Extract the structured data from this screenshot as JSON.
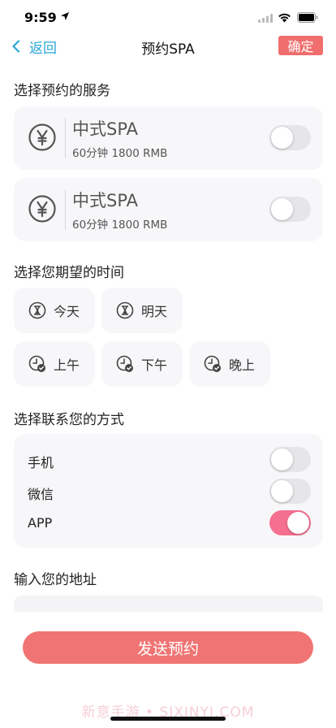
{
  "status_bar": {
    "time": "9:59"
  },
  "nav": {
    "back_label": "返回",
    "title": "预约SPA",
    "confirm_label": "确定"
  },
  "sections": {
    "service": "选择预约的服务",
    "time": "选择您期望的时间",
    "contact": "选择联系您的方式",
    "address": "输入您的地址"
  },
  "services": [
    {
      "name": "中式SPA",
      "detail": "60分钟   1800 RMB",
      "selected": false
    },
    {
      "name": "中式SPA",
      "detail": "60分钟   1800 RMB",
      "selected": false
    }
  ],
  "days": [
    {
      "label": "今天"
    },
    {
      "label": "明天"
    }
  ],
  "periods": [
    {
      "label": "上午"
    },
    {
      "label": "下午"
    },
    {
      "label": "晚上"
    }
  ],
  "contacts": [
    {
      "label": "手机",
      "enabled": false
    },
    {
      "label": "微信",
      "enabled": false
    },
    {
      "label": "APP",
      "enabled": true
    }
  ],
  "address": {
    "value": "",
    "placeholder": ""
  },
  "send_label": "发送预约",
  "watermark": "新意手游 • SIXINYI.COM",
  "colors": {
    "accent": "#f06e6e",
    "toggle_on": "#f56f90",
    "link": "#2aa6d8",
    "card_bg": "#f7f7f9"
  }
}
